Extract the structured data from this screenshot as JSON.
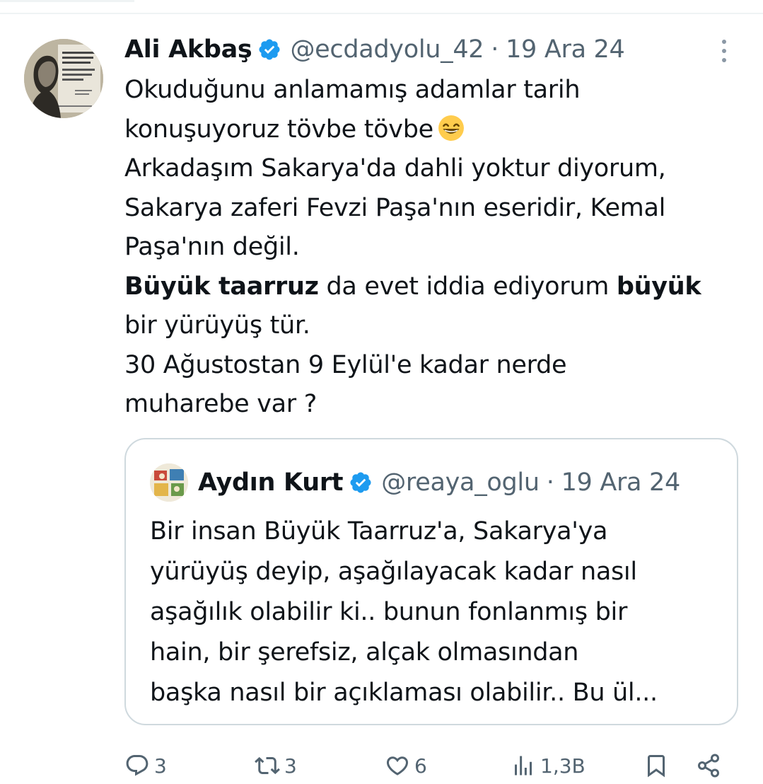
{
  "tweet": {
    "author_name": "Ali Akbaş",
    "handle": "@ecdadyolu_42",
    "separator": "·",
    "date": "19 Ara 24",
    "lines": [
      [
        {
          "t": "Okuduğunu anlamamış adamlar tarih",
          "b": false
        }
      ],
      [
        {
          "t": "konuşuyoruz tövbe tövbe",
          "b": false
        }
      ],
      [
        {
          "t": "Arkadaşım Sakarya'da dahli yoktur diyorum,",
          "b": false
        }
      ],
      [
        {
          "t": "Sakarya zaferi Fevzi Paşa'nın eseridir, Kemal",
          "b": false
        }
      ],
      [
        {
          "t": "Paşa'nın değil.",
          "b": false
        }
      ],
      [
        {
          "t": "Büyük taarruz",
          "b": true
        },
        {
          "t": " da evet iddia ediyorum ",
          "b": false
        },
        {
          "t": "büyük",
          "b": true
        }
      ],
      [
        {
          "t": "bir yürüyüş tür.",
          "b": false
        }
      ],
      [
        {
          "t": "30 Ağustostan 9 Eylül'e kadar nerde",
          "b": false
        }
      ],
      [
        {
          "t": "muharebe var ?",
          "b": false
        }
      ]
    ],
    "emoji_icon": "grinning-face-with-smiling-eyes"
  },
  "quote": {
    "author_name": "Aydın Kurt",
    "handle": "@reaya_oglu",
    "separator": "·",
    "date": "19 Ara 24",
    "lines": [
      "Bir insan Büyük Taarruz'a, Sakarya'ya",
      "yürüyüş deyip, aşağılayacak kadar nasıl",
      "aşağılık olabilir ki.. bunun fonlanmış bir",
      "hain, bir şerefsiz, alçak olmasından",
      "başka nasıl bir açıklaması olabilir.. Bu ül..."
    ]
  },
  "actions": {
    "replies": "3",
    "reposts": "3",
    "likes": "6",
    "views": "1,3B"
  },
  "colors": {
    "text": "#0f1419",
    "muted": "#536471",
    "verified": "#1d9bf0",
    "border": "#cfd9de"
  }
}
